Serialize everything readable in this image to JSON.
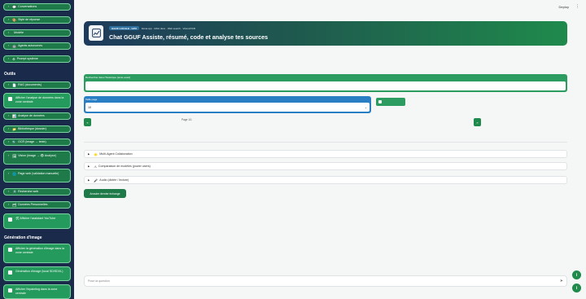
{
  "sidebar": {
    "top_buttons": [
      {
        "label": "Conversations",
        "icon": "💬"
      },
      {
        "label": "Style de réponse",
        "icon": "🎨"
      },
      {
        "label": "Modèle",
        "icon": ""
      },
      {
        "label": "Agents autonomes",
        "icon": "🤖"
      },
      {
        "label": "Prompt système",
        "icon": "⚙"
      }
    ],
    "tools_heading": "Outils",
    "tools": [
      {
        "label": "RAG (documents)",
        "icon": "📄"
      },
      {
        "label": "Afficher l'analyse de données dans la zone centrale",
        "icon": ""
      },
      {
        "label": "Analyse de données",
        "icon": "📊"
      },
      {
        "label": "Bibliothèque (dossier)",
        "icon": "📁"
      },
      {
        "label": "OCR (image → texte)",
        "icon": "🔍"
      },
      {
        "label": "Vision (image → 👁 Analyse)",
        "icon": "🖼"
      },
      {
        "label": "Page web (validation manuelle)",
        "icon": "🌐"
      },
      {
        "label": "Recherche web",
        "icon": "🔎"
      },
      {
        "label": "Données Personnelles",
        "icon": "🗂"
      },
      {
        "label": "🛠 Afficher l'assistant YouTube",
        "icon": ""
      }
    ],
    "image_heading": "Génération d'image",
    "image_tools": [
      {
        "label": "Afficher la génération d'image dans la zone centrale"
      },
      {
        "label": "Génération d'image (local SD/SDXL)"
      },
      {
        "label": "Afficher l'inpainting dans la zone centrale"
      }
    ]
  },
  "topbar": {
    "deploy": "Deploy",
    "menu_icon": "more-vertical-icon"
  },
  "hero": {
    "tag": "GGUF LOCALE · GPU",
    "tag_detail": "llama.cpp · RAG docs · Web search · Vision/OCR",
    "title": "Chat GGUF Assiste, résumé, code et analyse tes sources",
    "logo_icon": "chart-logo-icon"
  },
  "history_search": {
    "label": "Rechercher dans l'historique (texte exact)",
    "value": ""
  },
  "page_size": {
    "label": "Taille page",
    "value": "10"
  },
  "pagination": {
    "prev": "«",
    "next": "»",
    "info": "Page 1/1"
  },
  "accordions": [
    {
      "icon": "🌟",
      "label": "Multi-Agent Collaboration"
    },
    {
      "icon": "⚠",
      "label": "Comparaison de modèles (power users)"
    },
    {
      "icon": "🎤",
      "label": "Audio (dictée / lecture)"
    }
  ],
  "export_button": "Annuler dernier échange",
  "chat": {
    "placeholder": "Pose ta question"
  },
  "colors": {
    "sidebar_bg": "#1a2a4a",
    "accent_green": "#1f8a4c",
    "accent_blue": "#2a7fc4"
  }
}
